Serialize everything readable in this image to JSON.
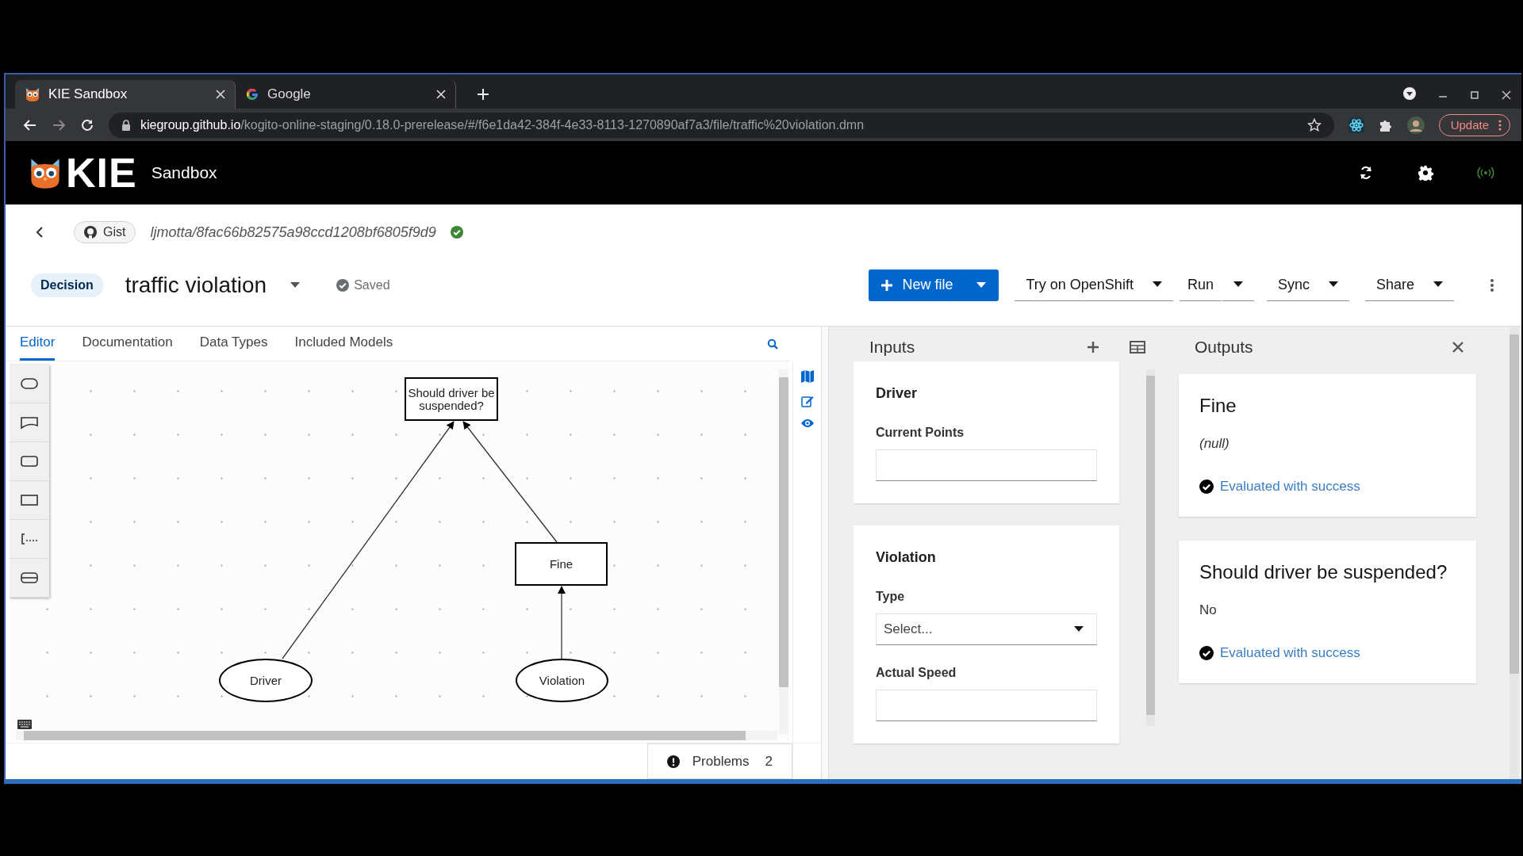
{
  "browser": {
    "tabs": [
      {
        "title": "KIE Sandbox",
        "kind": "owl",
        "selected": true
      },
      {
        "title": "Google",
        "kind": "google",
        "selected": false
      }
    ],
    "url_host": "kiegroup.github.io",
    "url_path": "/kogito-online-staging/0.18.0-prerelease/#/f6e1da42-384f-4e33-8113-1270890af7a3/file/traffic%20violation.dmn",
    "update_button": "Update"
  },
  "app_header": {
    "logo": "KIE",
    "product": "Sandbox"
  },
  "breadcrumb": {
    "gist_label": "Gist",
    "gist_path": "ljmotta/8fac66b82575a98ccd1208bf6805f9d9"
  },
  "file": {
    "type_badge": "Decision",
    "name": "traffic violation",
    "status": "Saved"
  },
  "toolbar": [
    {
      "label": "New file",
      "kind": "primary"
    },
    {
      "label": "Try on OpenShift",
      "kind": "dropdown"
    },
    {
      "label": "Run",
      "kind": "split"
    },
    {
      "label": "Sync",
      "kind": "dropdown"
    },
    {
      "label": "Share",
      "kind": "dropdown"
    }
  ],
  "editor_tabs": [
    {
      "label": "Editor",
      "selected": true
    },
    {
      "label": "Documentation",
      "selected": false
    },
    {
      "label": "Data Types",
      "selected": false
    },
    {
      "label": "Included Models",
      "selected": false
    }
  ],
  "diagram": {
    "nodes": [
      {
        "label": "Should driver be suspended?",
        "kind": "decision"
      },
      {
        "label": "Fine",
        "kind": "decision"
      },
      {
        "label": "Driver",
        "kind": "input"
      },
      {
        "label": "Violation",
        "kind": "input"
      }
    ],
    "edges": [
      {
        "kind": "information_requirement"
      },
      {
        "kind": "information_requirement"
      },
      {
        "kind": "information_requirement"
      }
    ]
  },
  "problems": {
    "label": "Problems",
    "count": "2"
  },
  "inputs": {
    "title": "Inputs",
    "groups": [
      {
        "name": "Driver",
        "fields": [
          {
            "label": "Current Points",
            "kind": "text"
          }
        ]
      },
      {
        "name": "Violation",
        "fields": [
          {
            "label": "Type",
            "kind": "select",
            "placeholder": "Select..."
          },
          {
            "label": "Actual Speed",
            "kind": "text"
          }
        ]
      }
    ]
  },
  "outputs": {
    "title": "Outputs",
    "results": [
      {
        "name": "Fine",
        "value": "(null)",
        "null": true,
        "status": "Evaluated with success"
      },
      {
        "name": "Should driver be suspended?",
        "value": "No",
        "null": false,
        "status": "Evaluated with success"
      }
    ]
  }
}
